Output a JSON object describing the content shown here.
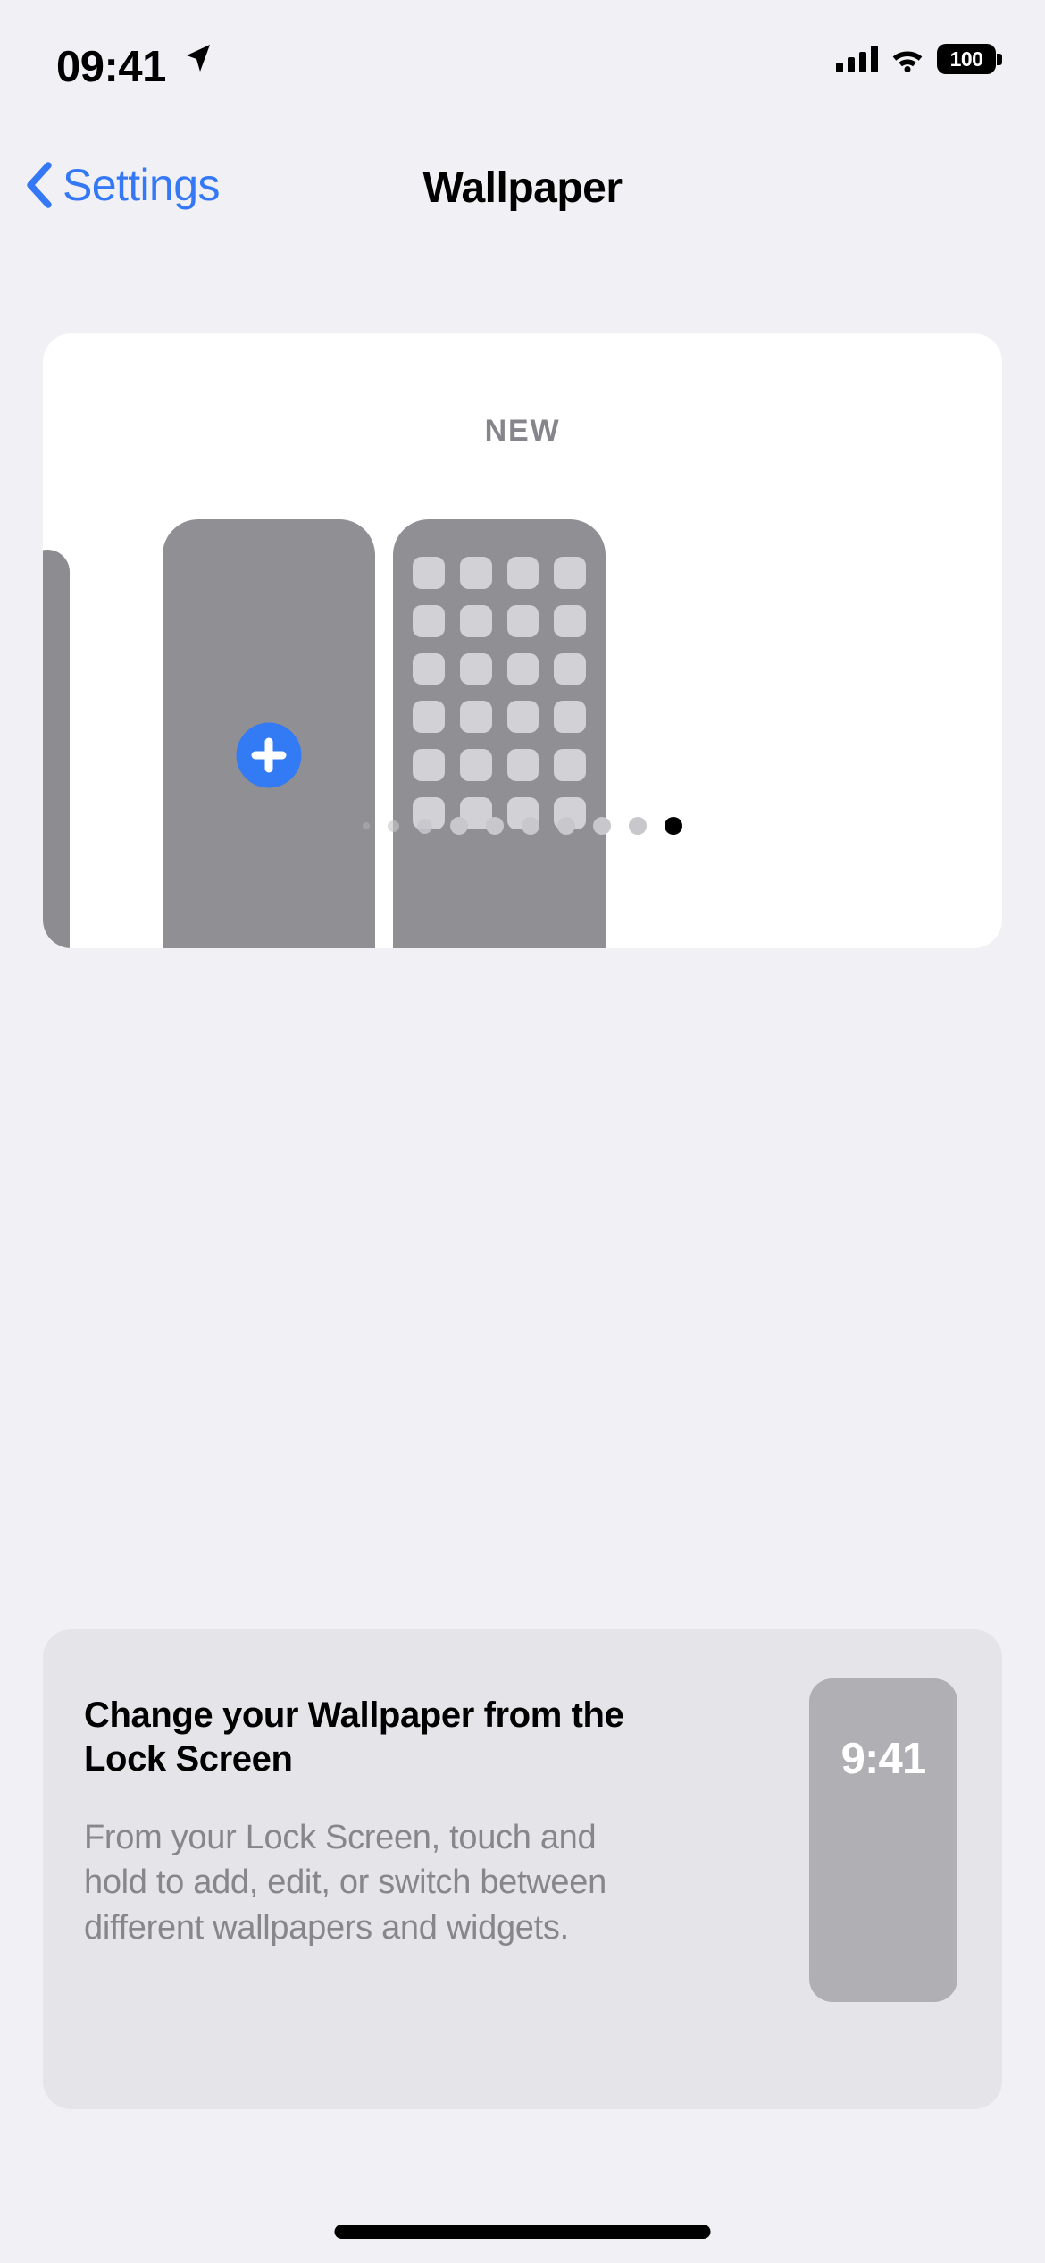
{
  "status_bar": {
    "time": "09:41",
    "location_icon": "location-arrow-icon",
    "cellular_icon": "cellular-bars-icon",
    "wifi_icon": "wifi-icon",
    "battery_level": "100",
    "battery_icon": "battery-full-icon"
  },
  "nav_bar": {
    "back_icon": "chevron-left-icon",
    "back_label": "Settings",
    "title": "Wallpaper"
  },
  "wallpaper_card": {
    "section_label": "NEW",
    "add_button": {
      "icon": "plus-icon",
      "label": ""
    },
    "tiles": [
      {
        "name": "previous-wallpaper-peek",
        "type": "partial"
      },
      {
        "name": "add-new-wallpaper",
        "type": "add"
      },
      {
        "name": "home-screen-preview",
        "type": "home-screen",
        "icon_rows": 6,
        "icon_columns": 4
      }
    ],
    "page_dots": {
      "total": 10,
      "active_index": 9,
      "sizes": [
        8,
        13,
        17,
        20,
        20,
        20,
        20,
        20,
        20,
        20
      ],
      "opacities": [
        0.35,
        0.6,
        0.85,
        1,
        1,
        1,
        1,
        1,
        1,
        1
      ]
    }
  },
  "info_card": {
    "title": "Change your Wallpaper from the Lock Screen",
    "body": "From your Lock Screen, touch and hold to add, edit, or switch between different wallpapers and widgets.",
    "preview": {
      "name": "lock-screen-preview",
      "time": "9:41"
    }
  },
  "home_indicator": {
    "name": "home-indicator"
  },
  "colors": {
    "page_background": "#F1F1F5",
    "card_background": "#FFFFFF",
    "info_card_background": "#E4E4E9",
    "accent_blue": "#337BF5",
    "link_blue": "#3478F6",
    "tile_gray": "#8F8F94",
    "app_icon_gray": "#D1D1D6",
    "secondary_text": "#86868B",
    "new_label_gray": "#85858B",
    "lock_preview_gray": "#AFAFB4",
    "dot_gray": "#C7C7CC",
    "dot_active": "#000000"
  }
}
